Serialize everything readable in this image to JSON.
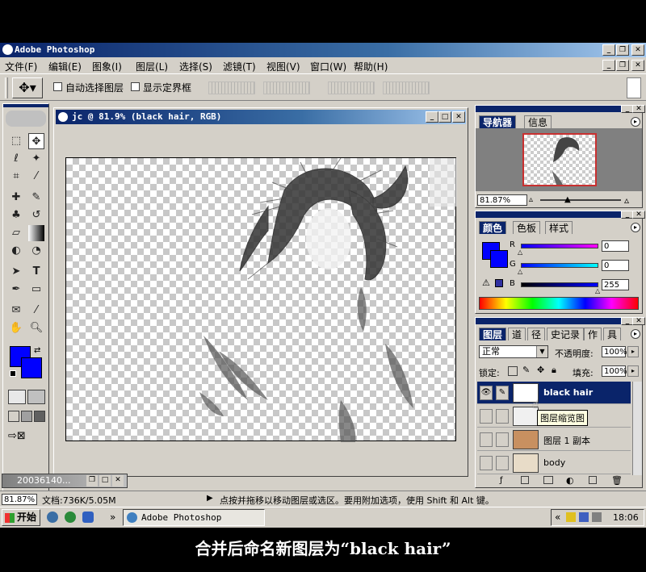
{
  "app": {
    "title": "Adobe Photoshop"
  },
  "menu": [
    "文件(F)",
    "编辑(E)",
    "图象(I)",
    "图层(L)",
    "选择(S)",
    "滤镜(T)",
    "视图(V)",
    "窗口(W)",
    "帮助(H)"
  ],
  "options": {
    "auto_select": "自动选择图层",
    "show_bounds": "显示定界框"
  },
  "document": {
    "title": "jc @ 81.9% (black hair, RGB)"
  },
  "navigator": {
    "tab_active": "导航器",
    "tab2": "信息",
    "zoom": "81.87%"
  },
  "color": {
    "tab_active": "颜色",
    "tab2": "色板",
    "tab3": "样式",
    "r_label": "R",
    "g_label": "G",
    "b_label": "B",
    "r": "0",
    "g": "0",
    "b": "255",
    "fg": "#0000ff",
    "bg": "#0000ff"
  },
  "layers": {
    "tab_active": "图层",
    "tab2": "通道",
    "tab3": "路径",
    "tab4": "历史记录",
    "tab5": "动作",
    "tab6": "工具",
    "blend_mode": "正常",
    "opacity_label": "不透明度:",
    "opacity": "100%",
    "lock_label": "锁定:",
    "fill_label": "填充:",
    "fill": "100%",
    "tooltip": "图层缩览图",
    "items": [
      {
        "name": "black hair",
        "selected": true
      },
      {
        "name": "",
        "selected": false
      },
      {
        "name": "图层 1 副本",
        "selected": false
      },
      {
        "name": "body",
        "selected": false
      }
    ]
  },
  "minimized": {
    "label": "20036140..."
  },
  "status": {
    "zoom": "81.87%",
    "doc": "文档:736K/5.05M",
    "hint": "点按并拖移以移动图层或选区。要用附加选项，使用 Shift 和 Alt 键。"
  },
  "taskbar": {
    "start": "开始",
    "task": "Adobe Photoshop",
    "time": "18:06",
    "chevron": "«"
  },
  "caption": "合并后命名新图层为“black hair”"
}
